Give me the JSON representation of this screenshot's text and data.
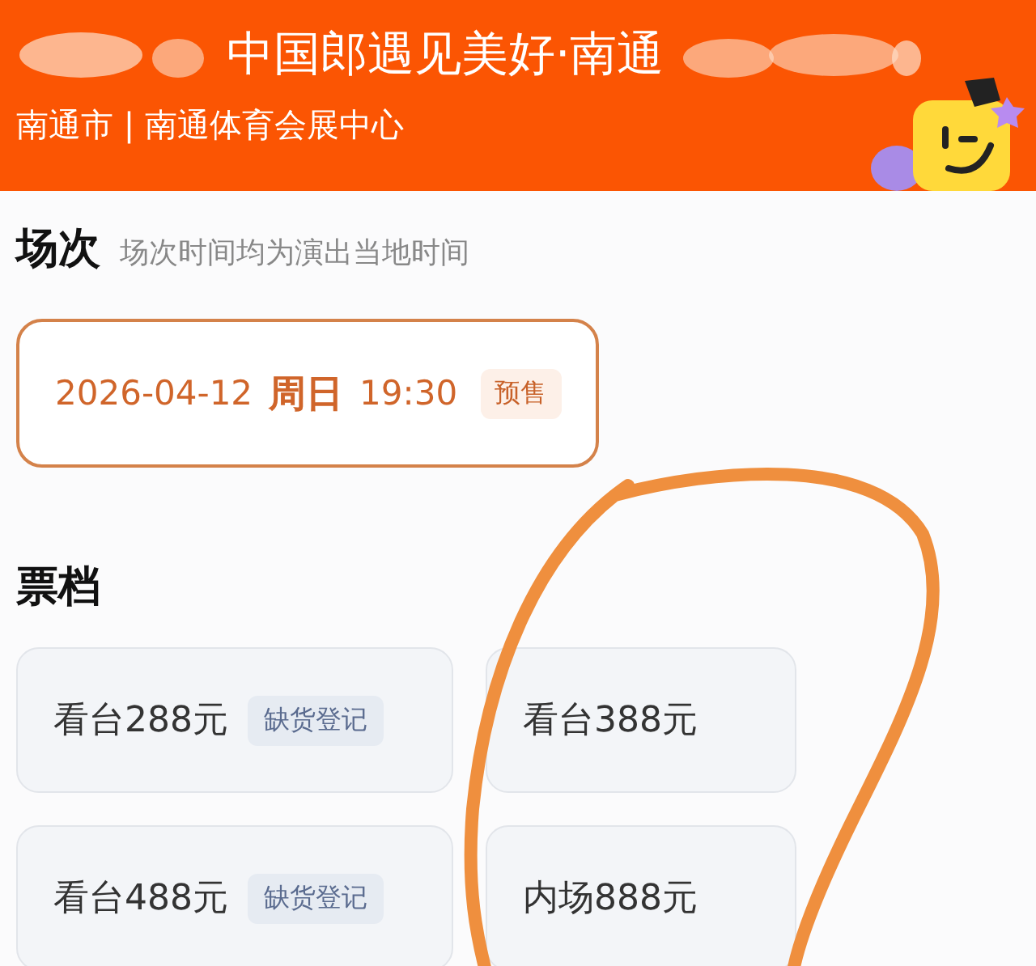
{
  "header": {
    "title": "中国郎遇见美好·南通",
    "location": "南通市 | 南通体育会展中心"
  },
  "sessions_section": {
    "title": "场次",
    "note": "场次时间均为演出当地时间"
  },
  "sessions": [
    {
      "date": "2026-04-12",
      "weekday": "周日",
      "time": "19:30",
      "badge": "预售",
      "selected": true
    }
  ],
  "tiers_section": {
    "title": "票档"
  },
  "tiers": [
    {
      "label": "看台288元",
      "badge": "缺货登记"
    },
    {
      "label": "看台388元"
    },
    {
      "label": "看台488元",
      "badge": "缺货登记"
    },
    {
      "label": "内场888元"
    }
  ],
  "annotation": {
    "kind": "circle"
  }
}
